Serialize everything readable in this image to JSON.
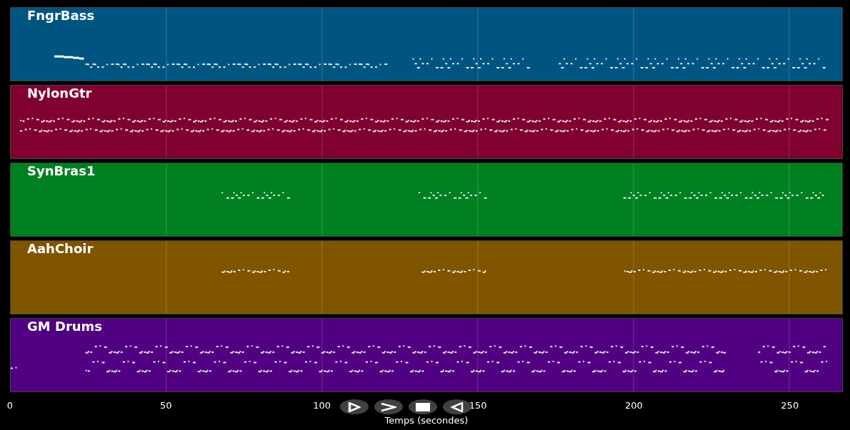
{
  "tracks": [
    {
      "name": "FngrBass",
      "color": "#005580"
    },
    {
      "name": "NylonGtr",
      "color": "#800030"
    },
    {
      "name": "SynBras1",
      "color": "#008020"
    },
    {
      "name": "AahChoir",
      "color": "#805500"
    },
    {
      "name": "GM Drums",
      "color": "#500080"
    }
  ],
  "x_axis": {
    "ticks": [
      "0",
      "50",
      "100",
      "150",
      "200",
      "250"
    ],
    "label": "Temps (secondes)"
  },
  "controls": [
    {
      "kind": "play"
    },
    {
      "kind": "forward"
    },
    {
      "kind": "stop"
    },
    {
      "kind": "back"
    }
  ]
}
